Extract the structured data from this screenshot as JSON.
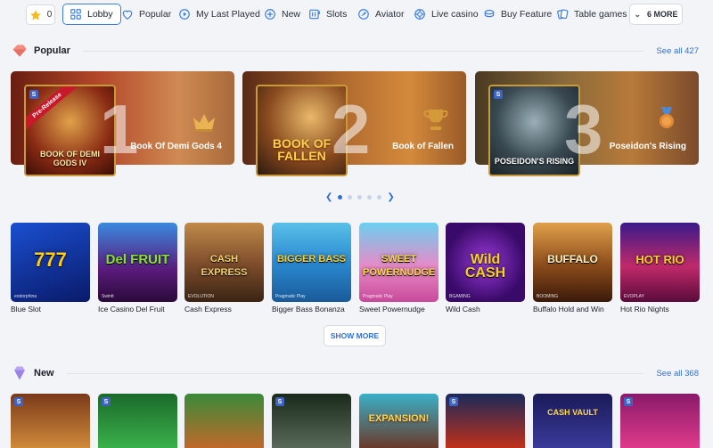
{
  "nav": {
    "favorites_count": "0",
    "items": [
      {
        "label": "Lobby",
        "icon": "home-icon"
      },
      {
        "label": "Popular",
        "icon": "heart-icon"
      },
      {
        "label": "My Last Played",
        "icon": "play-circle-icon"
      },
      {
        "label": "New",
        "icon": "plus-circle-icon"
      },
      {
        "label": "Slots",
        "icon": "slot-machine-icon"
      },
      {
        "label": "Aviator",
        "icon": "aviator-icon"
      },
      {
        "label": "Live casino",
        "icon": "live-casino-icon"
      },
      {
        "label": "Buy Feature",
        "icon": "coins-icon"
      },
      {
        "label": "Table games",
        "icon": "cards-icon"
      }
    ],
    "more_label": "6 MORE"
  },
  "popular": {
    "title": "Popular",
    "see_all": "See all 427",
    "banners": [
      {
        "rank": "1",
        "name": "Book Of Demi Gods 4",
        "tag": "Pre-Release",
        "tile_title": "BOOK OF DEMI GODS IV",
        "trophy": "crown-icon"
      },
      {
        "rank": "2",
        "name": "Book of Fallen",
        "tag": "",
        "tile_title": "BOOK OF FALLEN",
        "trophy": "trophy-icon"
      },
      {
        "rank": "3",
        "name": "Poseidon's Rising",
        "tag": "",
        "tile_title": "POSEIDON'S RISING",
        "trophy": "medal-icon"
      }
    ],
    "games": [
      {
        "name": "Blue Slot",
        "logo": "777",
        "provider": "endorphina"
      },
      {
        "name": "Ice Casino Del Fruit",
        "logo": "Del FRUIT",
        "provider": "Swintt"
      },
      {
        "name": "Cash Express",
        "logo": "CASH EXPRESS",
        "provider": "EVOLUTION"
      },
      {
        "name": "Bigger Bass Bonanza",
        "logo": "BIGGER BASS",
        "provider": "Pragmatic Play"
      },
      {
        "name": "Sweet Powernudge",
        "logo": "SWEET POWERNUDGE",
        "provider": "Pragmatic Play"
      },
      {
        "name": "Wild Cash",
        "logo": "Wild CASH",
        "provider": "BGAMING"
      },
      {
        "name": "Buffalo Hold and Win",
        "logo": "BUFFALO",
        "provider": "BOOMING"
      },
      {
        "name": "Hot Rio Nights",
        "logo": "HOT RIO",
        "provider": "EVOPLAY"
      }
    ],
    "show_more": "SHOW MORE"
  },
  "new_section": {
    "title": "New",
    "see_all": "See all 368",
    "games": [
      {
        "logo": ""
      },
      {
        "logo": ""
      },
      {
        "logo": ""
      },
      {
        "logo": ""
      },
      {
        "logo": "EXPANSION!"
      },
      {
        "logo": ""
      },
      {
        "logo": "CASH VAULT"
      },
      {
        "logo": ""
      }
    ]
  },
  "colors": {
    "accent": "#2f6fd6",
    "active_border": "#3b7de0",
    "background": "#f3f4f7"
  }
}
